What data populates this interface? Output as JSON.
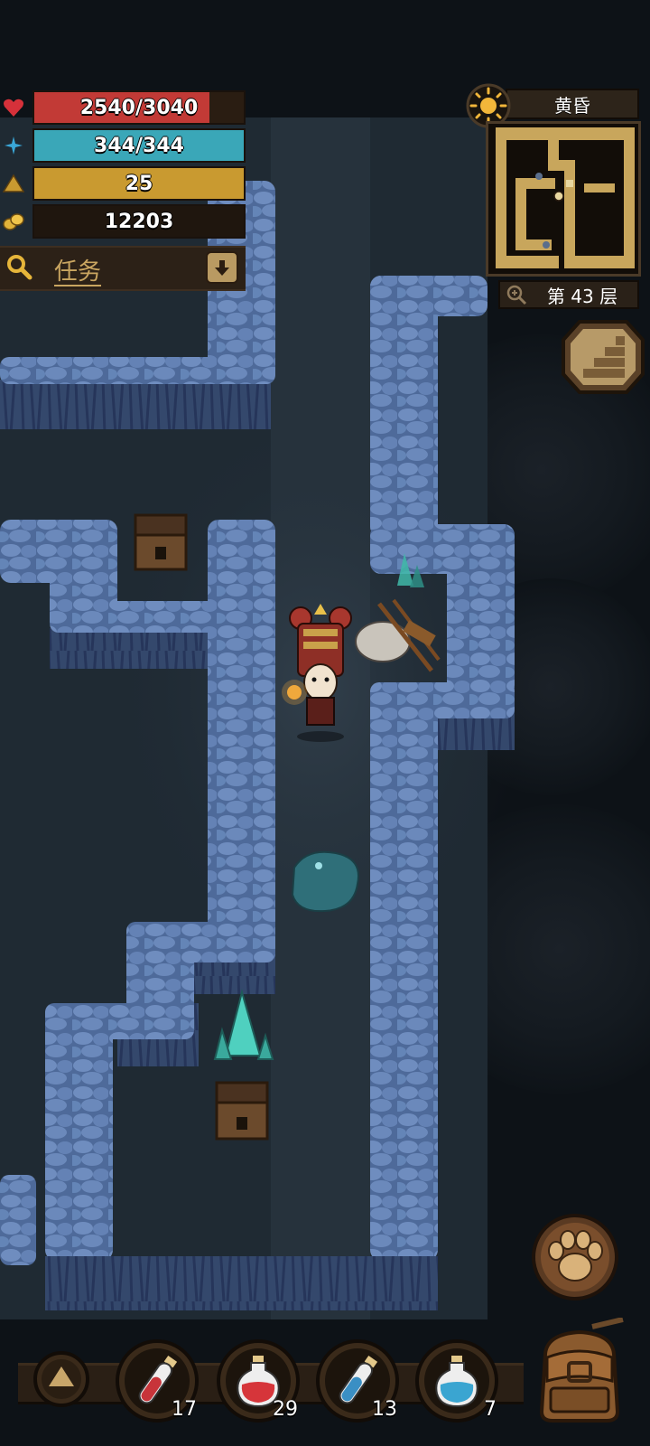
{
  "stats": {
    "health": {
      "text": "2540/3040",
      "fraction": 0.836,
      "color": "#c23a36"
    },
    "mana": {
      "text": "344/344",
      "fraction": 1.0,
      "color": "#3aa7b8"
    },
    "level": {
      "text": "25",
      "fraction": 1.0,
      "color": "#c99a30"
    },
    "gold": {
      "text": "12203"
    }
  },
  "quest": {
    "label": "任务",
    "icon": "search-icon"
  },
  "minimap": {
    "time_of_day": "黄昏",
    "floor_label": "第 43 层"
  },
  "actions": {
    "stairs": "stairs-icon",
    "pet": "paw-icon",
    "inventory": "backpack-icon"
  },
  "hotbar": {
    "toggle": "triangle-up-icon",
    "items": [
      {
        "icon": "health-potion-small-icon",
        "count": "17",
        "color": "#c8343a"
      },
      {
        "icon": "health-potion-large-icon",
        "count": "29",
        "color": "#d6353a"
      },
      {
        "icon": "mana-potion-small-icon",
        "count": "13",
        "color": "#3a8fc4"
      },
      {
        "icon": "mana-potion-large-icon",
        "count": "7",
        "color": "#3aa5d1"
      }
    ]
  }
}
